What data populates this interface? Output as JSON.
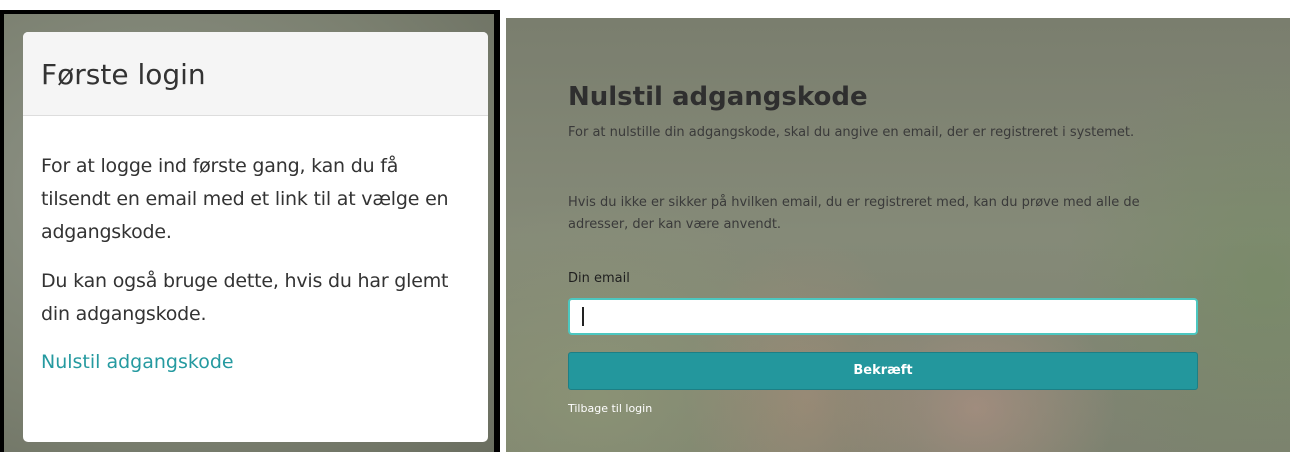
{
  "left_card": {
    "title": "Første login",
    "paragraph1": "For at logge ind første gang, kan du få tilsendt en email med et link til at vælge en adgangskode.",
    "paragraph2": "Du kan også bruge dette, hvis du har glemt din adgangskode.",
    "link": "Nulstil adgangskode"
  },
  "reset_form": {
    "title": "Nulstil adgangskode",
    "paragraph1": "For at nulstille din adgangskode, skal du angive en email, der er registreret i systemet.",
    "paragraph2": "Hvis du ikke er sikker på hvilken email, du er registreret med, kan du prøve med alle de adresser, der kan være anvendt.",
    "email_label": "Din email",
    "email_value": "",
    "confirm_label": "Bekræft",
    "back_link": "Tilbage til login"
  },
  "colors": {
    "accent": "#23979d",
    "link": "#259aa0",
    "input_focus_border": "#4cc7c0"
  }
}
